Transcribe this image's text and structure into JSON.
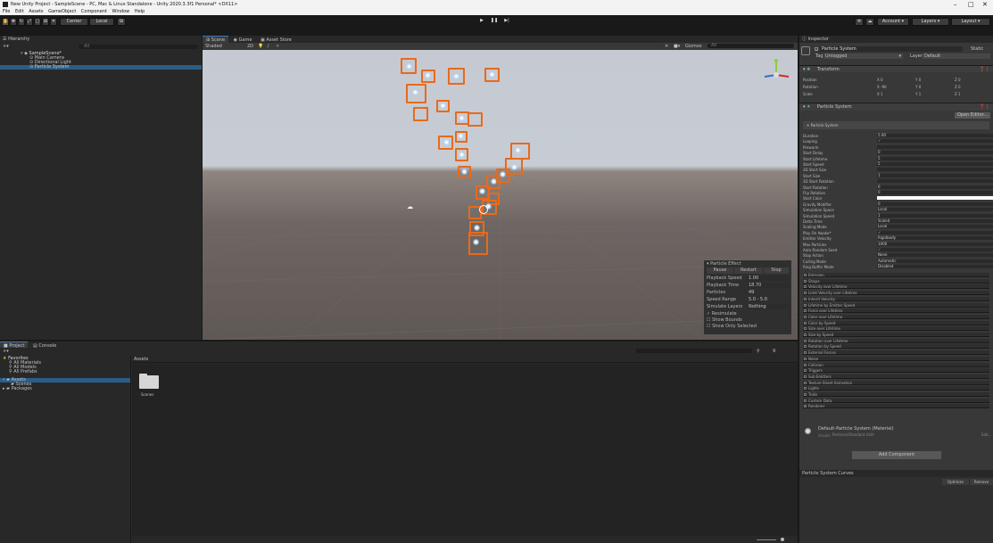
{
  "window": {
    "title": "New Unity Project - SampleScene - PC, Mac & Linux Standalone - Unity 2020.3.3f1 Personal* <DX11>",
    "minimize": "–",
    "maximize": "□",
    "close": "✕"
  },
  "menu": [
    "File",
    "Edit",
    "Assets",
    "GameObject",
    "Component",
    "Window",
    "Help"
  ],
  "toolbar": {
    "center": "Center",
    "local": "Local",
    "play": "▶",
    "pause": "❚❚",
    "step": "▶|",
    "account": "Account",
    "layers": "Layers",
    "layout": "Layout"
  },
  "hierarchy": {
    "tab": "Hierarchy",
    "search_placeholder": "All",
    "scene": "SampleScene*",
    "items": [
      "Main Camera",
      "Directional Light",
      "Particle System"
    ]
  },
  "scene": {
    "tabs": [
      "Scene",
      "Game",
      "Asset Store"
    ],
    "shading": "Shaded",
    "mode2d": "2D",
    "gizmos": "Gizmos",
    "search": "All"
  },
  "particle_effect": {
    "title": "Particle Effect",
    "pause": "Pause",
    "restart": "Restart",
    "stop": "Stop",
    "rows": [
      {
        "label": "Playback Speed",
        "value": "1.00"
      },
      {
        "label": "Playback Time",
        "value": "18.70"
      },
      {
        "label": "Particles",
        "value": "49"
      },
      {
        "label": "Speed Range",
        "value": "5.0 - 5.0"
      },
      {
        "label": "Simulate Layers",
        "value": "Nothing"
      }
    ],
    "checks": [
      {
        "label": "Resimulate",
        "checked": true
      },
      {
        "label": "Show Bounds",
        "checked": false
      },
      {
        "label": "Show Only Selected",
        "checked": false
      }
    ]
  },
  "project": {
    "tabs": [
      "Project",
      "Console"
    ],
    "favorites": "Favorites",
    "fav_items": [
      "All Materials",
      "All Models",
      "All Prefabs"
    ],
    "assets": "Assets",
    "asset_items": [
      "Scenes"
    ],
    "packages": "Packages",
    "breadcrumb": "Assets",
    "folder": "Scenes",
    "count": "9"
  },
  "inspector": {
    "tab": "Inspector",
    "object_name": "Particle System",
    "static": "Static",
    "tag_label": "Tag",
    "tag": "Untagged",
    "layer_label": "Layer",
    "layer": "Default",
    "transform": {
      "title": "Transform",
      "rows": [
        {
          "label": "Position",
          "x": "0",
          "y": "0",
          "z": "0"
        },
        {
          "label": "Rotation",
          "x": "-90",
          "y": "0",
          "z": "0"
        },
        {
          "label": "Scale",
          "x": "1",
          "y": "1",
          "z": "1"
        }
      ]
    },
    "ps_title": "Particle System",
    "open_editor": "Open Editor...",
    "ps_sub": "Particle System",
    "props": [
      {
        "l": "Duration",
        "v": "5.00"
      },
      {
        "l": "Looping",
        "v": "✓"
      },
      {
        "l": "Prewarm",
        "v": ""
      },
      {
        "l": "Start Delay",
        "v": "0"
      },
      {
        "l": "Start Lifetime",
        "v": "5"
      },
      {
        "l": "Start Speed",
        "v": "5"
      },
      {
        "l": "3D Start Size",
        "v": ""
      },
      {
        "l": "Start Size",
        "v": "1"
      },
      {
        "l": "3D Start Rotation",
        "v": ""
      },
      {
        "l": "Start Rotation",
        "v": "0"
      },
      {
        "l": "Flip Rotation",
        "v": "0"
      },
      {
        "l": "Start Color",
        "v": ""
      },
      {
        "l": "Gravity Modifier",
        "v": "0"
      },
      {
        "l": "Simulation Space",
        "v": "Local"
      },
      {
        "l": "Simulation Speed",
        "v": "1"
      },
      {
        "l": "Delta Time",
        "v": "Scaled"
      },
      {
        "l": "Scaling Mode",
        "v": "Local"
      },
      {
        "l": "Play On Awake*",
        "v": "✓"
      },
      {
        "l": "Emitter Velocity",
        "v": "Rigidbody"
      },
      {
        "l": "Max Particles",
        "v": "1000"
      },
      {
        "l": "Auto Random Seed",
        "v": "✓"
      },
      {
        "l": "Stop Action",
        "v": "None"
      },
      {
        "l": "Culling Mode",
        "v": "Automatic"
      },
      {
        "l": "Ring Buffer Mode",
        "v": "Disabled"
      }
    ],
    "modules": [
      {
        "l": "Emission",
        "c": true
      },
      {
        "l": "Shape",
        "c": true
      },
      {
        "l": "Velocity over Lifetime",
        "c": false
      },
      {
        "l": "Limit Velocity over Lifetime",
        "c": false
      },
      {
        "l": "Inherit Velocity",
        "c": false
      },
      {
        "l": "Lifetime by Emitter Speed",
        "c": false
      },
      {
        "l": "Force over Lifetime",
        "c": false
      },
      {
        "l": "Color over Lifetime",
        "c": false
      },
      {
        "l": "Color by Speed",
        "c": false
      },
      {
        "l": "Size over Lifetime",
        "c": false
      },
      {
        "l": "Size by Speed",
        "c": false
      },
      {
        "l": "Rotation over Lifetime",
        "c": false
      },
      {
        "l": "Rotation by Speed",
        "c": false
      },
      {
        "l": "External Forces",
        "c": false
      },
      {
        "l": "Noise",
        "c": false
      },
      {
        "l": "Collision",
        "c": false
      },
      {
        "l": "Triggers",
        "c": false
      },
      {
        "l": "Sub Emitters",
        "c": false
      },
      {
        "l": "Texture Sheet Animation",
        "c": false
      },
      {
        "l": "Lights",
        "c": false
      },
      {
        "l": "Trails",
        "c": false
      },
      {
        "l": "Custom Data",
        "c": false
      },
      {
        "l": "Renderer",
        "c": true
      }
    ],
    "material": "Default-Particle System (Material)",
    "shader_label": "Shader",
    "shader": "Particles/Standard Unlit",
    "edit": "Edit...",
    "add_component": "Add Component",
    "curves": "Particle System Curves",
    "optimize": "Optimize",
    "remove": "Remove"
  },
  "colors": {
    "selection": "#2c5d87",
    "orange": "#e86a1c",
    "sky": "#c2c9d3"
  }
}
